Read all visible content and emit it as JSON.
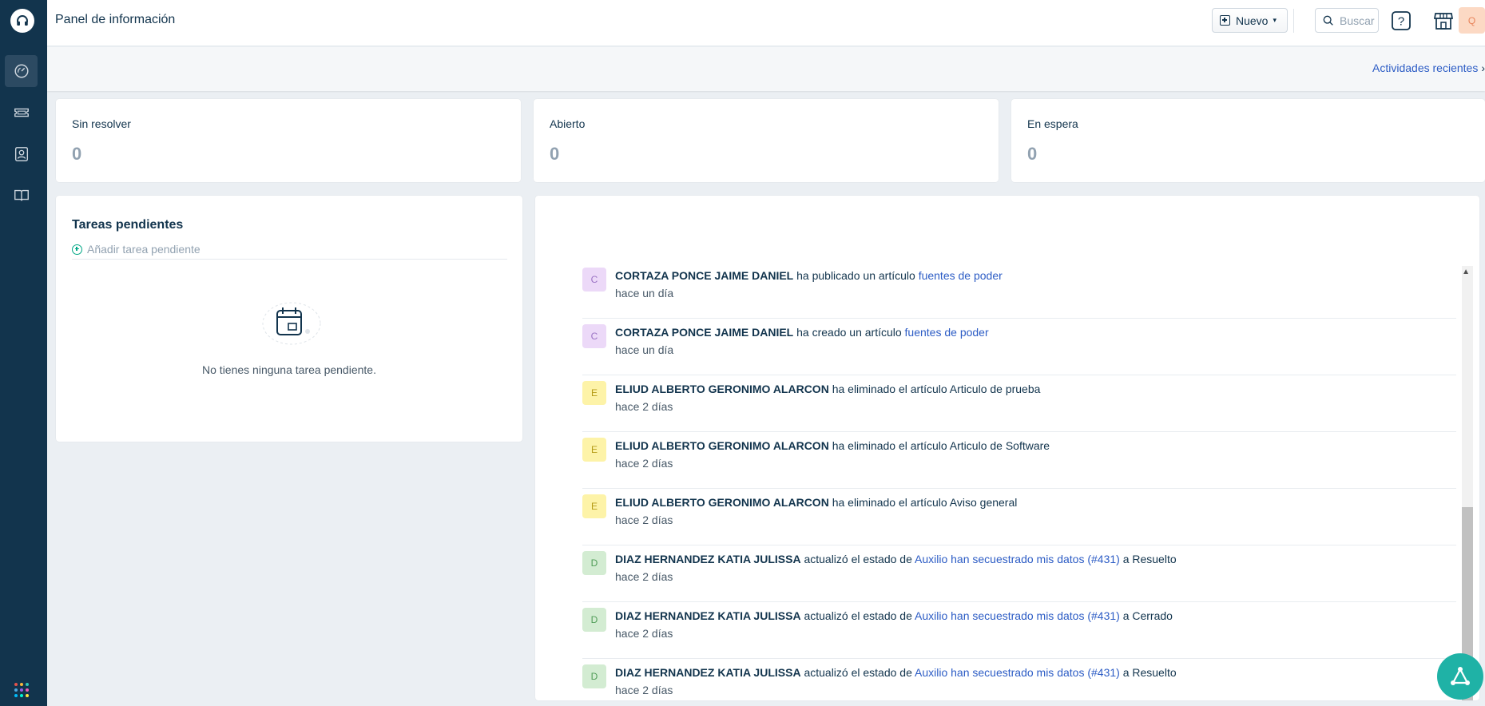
{
  "header": {
    "title": "Panel de información",
    "new_label": "Nuevo",
    "search_placeholder": "Buscar",
    "avatar_initial": "Q"
  },
  "subbar": {
    "recent_activities": "Actividades recientes"
  },
  "stats": [
    {
      "label": "Sin resolver",
      "value": "0"
    },
    {
      "label": "Abierto",
      "value": "0"
    },
    {
      "label": "En espera",
      "value": "0"
    }
  ],
  "todo": {
    "title": "Tareas pendientes",
    "add_placeholder": "Añadir tarea pendiente",
    "empty_text": "No tienes ninguna tarea pendiente."
  },
  "feed": [
    {
      "initial": "C",
      "actor": "CORTAZA PONCE JAIME DANIEL",
      "action": " ha publicado un artículo ",
      "link": "fuentes de poder",
      "suffix": "",
      "time": "hace un día",
      "color": "#ecd9f8"
    },
    {
      "initial": "C",
      "actor": "CORTAZA PONCE JAIME DANIEL",
      "action": " ha creado un artículo ",
      "link": "fuentes de poder",
      "suffix": "",
      "time": "hace un día",
      "color": "#ecd9f8"
    },
    {
      "initial": "E",
      "actor": "ELIUD ALBERTO GERONIMO ALARCON",
      "action": " ha eliminado el artículo Articulo de prueba",
      "link": "",
      "suffix": "",
      "time": "hace 2 días",
      "color": "#fdf3a8"
    },
    {
      "initial": "E",
      "actor": "ELIUD ALBERTO GERONIMO ALARCON",
      "action": " ha eliminado el artículo Articulo de Software",
      "link": "",
      "suffix": "",
      "time": "hace 2 días",
      "color": "#fdf3a8"
    },
    {
      "initial": "E",
      "actor": "ELIUD ALBERTO GERONIMO ALARCON",
      "action": " ha eliminado el artículo Aviso general",
      "link": "",
      "suffix": "",
      "time": "hace 2 días",
      "color": "#fdf3a8"
    },
    {
      "initial": "D",
      "actor": "DIAZ HERNANDEZ KATIA JULISSA",
      "action": " actualizó el estado de ",
      "link": "Auxilio han secuestrado mis datos (#431)",
      "suffix": " a Resuelto",
      "time": "hace 2 días",
      "color": "#d3ecd2"
    },
    {
      "initial": "D",
      "actor": "DIAZ HERNANDEZ KATIA JULISSA",
      "action": " actualizó el estado de ",
      "link": "Auxilio han secuestrado mis datos (#431)",
      "suffix": " a Cerrado",
      "time": "hace 2 días",
      "color": "#d3ecd2"
    },
    {
      "initial": "D",
      "actor": "DIAZ HERNANDEZ KATIA JULISSA",
      "action": " actualizó el estado de ",
      "link": "Auxilio han secuestrado mis datos (#431)",
      "suffix": " a Resuelto",
      "time": "hace 2 días",
      "color": "#d3ecd2"
    }
  ],
  "colors": {
    "sidebar": "#12344d",
    "link": "#2c5cc5",
    "fab": "#1fb2a6"
  }
}
